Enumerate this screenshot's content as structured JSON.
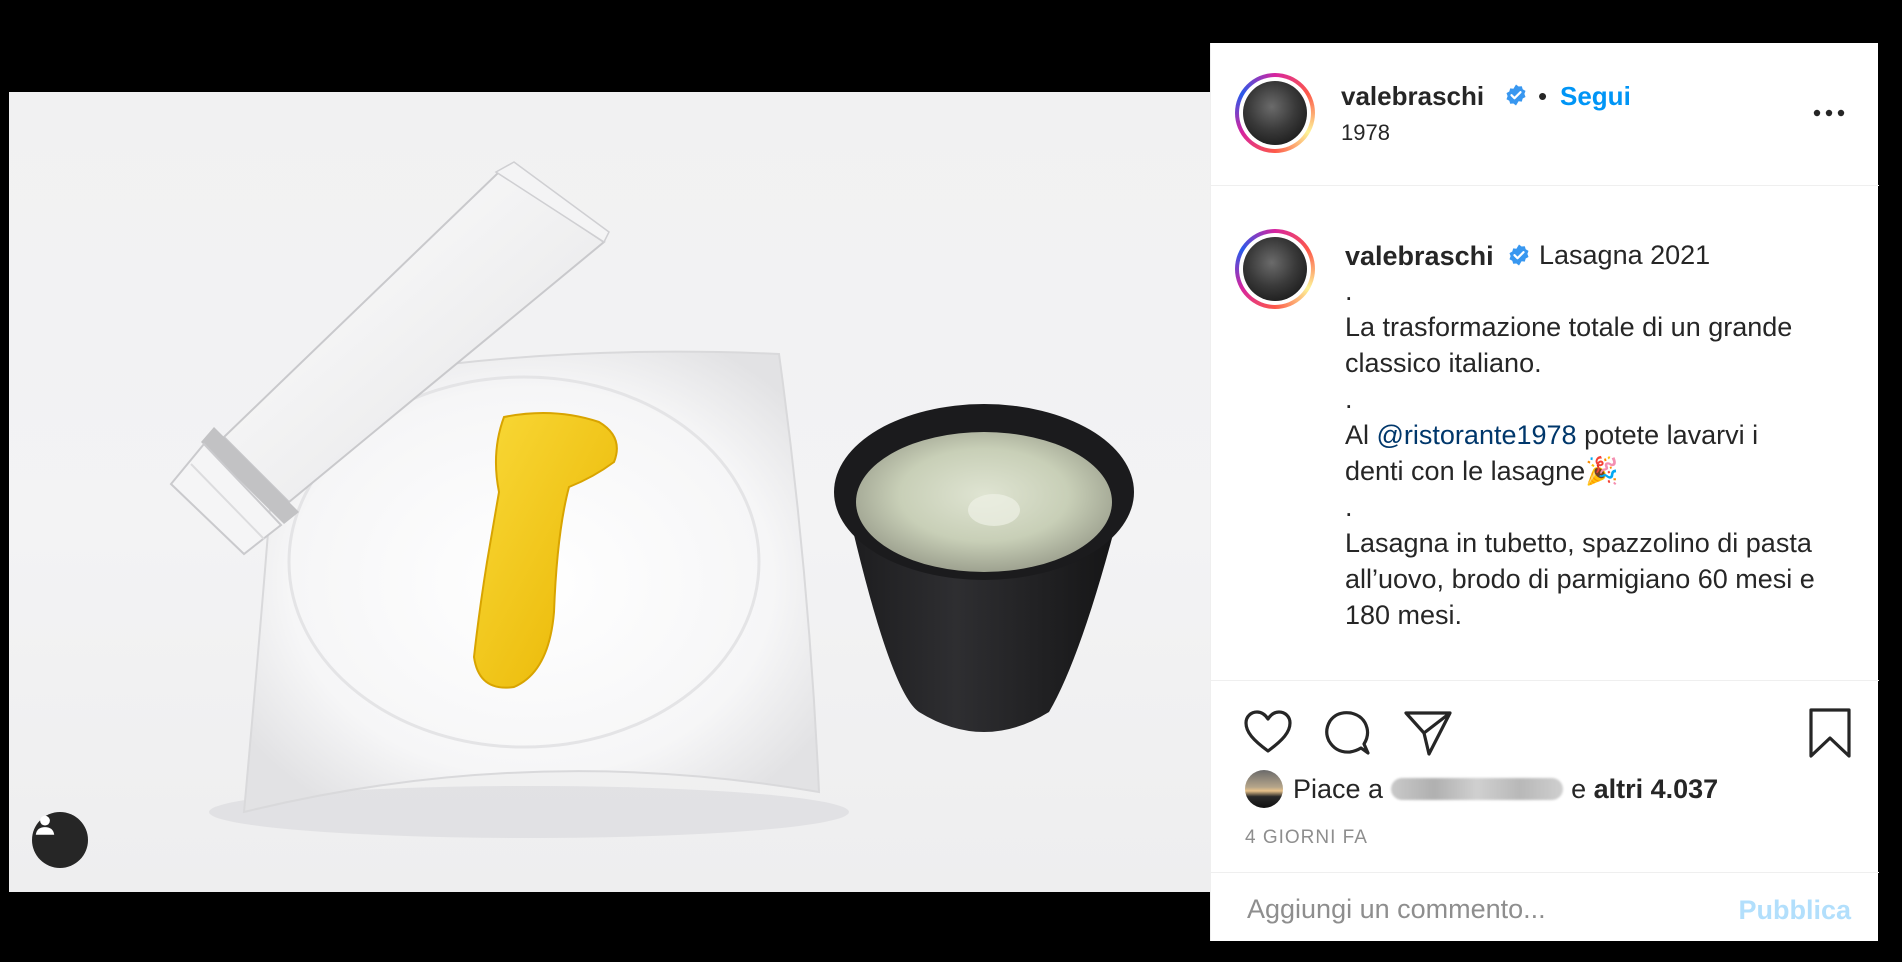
{
  "post": {
    "username": "valebraschi",
    "verified_icon": "verified-badge-icon",
    "separator": "•",
    "follow_label": "Segui",
    "location": "1978",
    "more_icon": "more-options-icon"
  },
  "caption": {
    "username": "valebraschi",
    "title": "Lasagna 2021",
    "lines": [
      ".",
      "La trasformazione totale di un grande",
      "classico italiano.",
      ".",
      "Al ",
      "potete lavarvi i",
      "denti con le lasagne🎉",
      ".",
      "Lasagna in tubetto, spazzolino di pasta",
      "all’uovo, brodo di parmigiano 60 mesi e",
      "180 mesi."
    ],
    "mention": "@ristorante1978"
  },
  "actions": {
    "like_icon": "heart-icon",
    "comment_icon": "comment-bubble-icon",
    "share_icon": "paper-plane-icon",
    "save_icon": "bookmark-icon"
  },
  "likes": {
    "prefix": "Piace a",
    "connector": "e",
    "others": "altri 4.037"
  },
  "timestamp": "4 GIORNI FA",
  "comment": {
    "placeholder": "Aggiungi un commento...",
    "publish_label": "Pubblica"
  },
  "colors": {
    "accent": "#0095f6",
    "publish_disabled": "#b2dffc",
    "text": "#262626",
    "muted": "#8e8e8e",
    "mention": "#00376b"
  }
}
